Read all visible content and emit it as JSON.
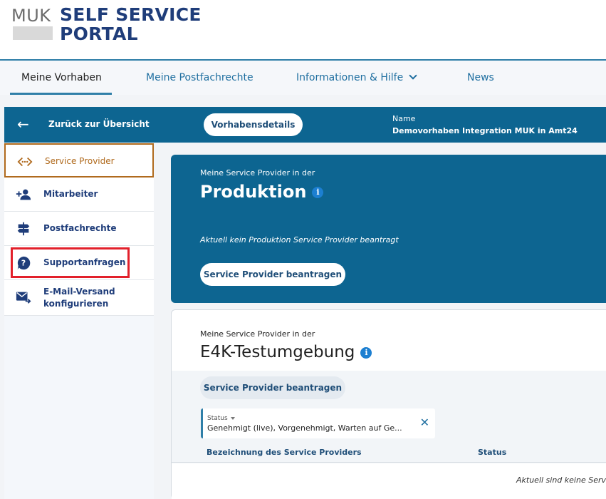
{
  "logo": {
    "muk": "MUK",
    "line1": "SELF SERVICE",
    "line2": "PORTAL"
  },
  "topnav": {
    "items": [
      {
        "label": "Meine Vorhaben"
      },
      {
        "label": "Meine Postfachrechte"
      },
      {
        "label": "Informationen & Hilfe"
      },
      {
        "label": "News"
      }
    ]
  },
  "sidebar": {
    "back_label": "Zurück zur Übersicht",
    "items": [
      {
        "label": "Service Provider",
        "icon": "code-arrows-icon"
      },
      {
        "label": "Mitarbeiter",
        "icon": "person-add-icon"
      },
      {
        "label": "Postfachrechte",
        "icon": "signpost-icon"
      },
      {
        "label": "Supportanfragen",
        "icon": "help-bubble-icon"
      },
      {
        "label": "E-Mail-Versand konfigurieren",
        "icon": "mail-forward-icon"
      }
    ]
  },
  "main": {
    "details_button": "Vorhabensdetails",
    "name_label": "Name",
    "name_value": "Demovorhaben Integration MUK in Amt24",
    "production": {
      "subtitle": "Meine Service Provider in der",
      "title": "Produktion",
      "note": "Aktuell kein Produktion Service Provider beantragt",
      "button": "Service Provider beantragen"
    },
    "test": {
      "subtitle": "Meine Service Provider in der",
      "title": "E4K-Testumgebung",
      "button": "Service Provider beantragen",
      "filter_label": "Status",
      "filter_value": "Genehmigt (live), Vorgenehmigt, Warten auf Ge...",
      "col_name": "Bezeichnung des Service Providers",
      "col_status": "Status",
      "empty_text": "Aktuell sind keine Servi"
    }
  },
  "colors": {
    "primary": "#0d6591",
    "accent": "#b06a1d",
    "highlight": "#e2202b",
    "brand": "#1f3d7a"
  }
}
